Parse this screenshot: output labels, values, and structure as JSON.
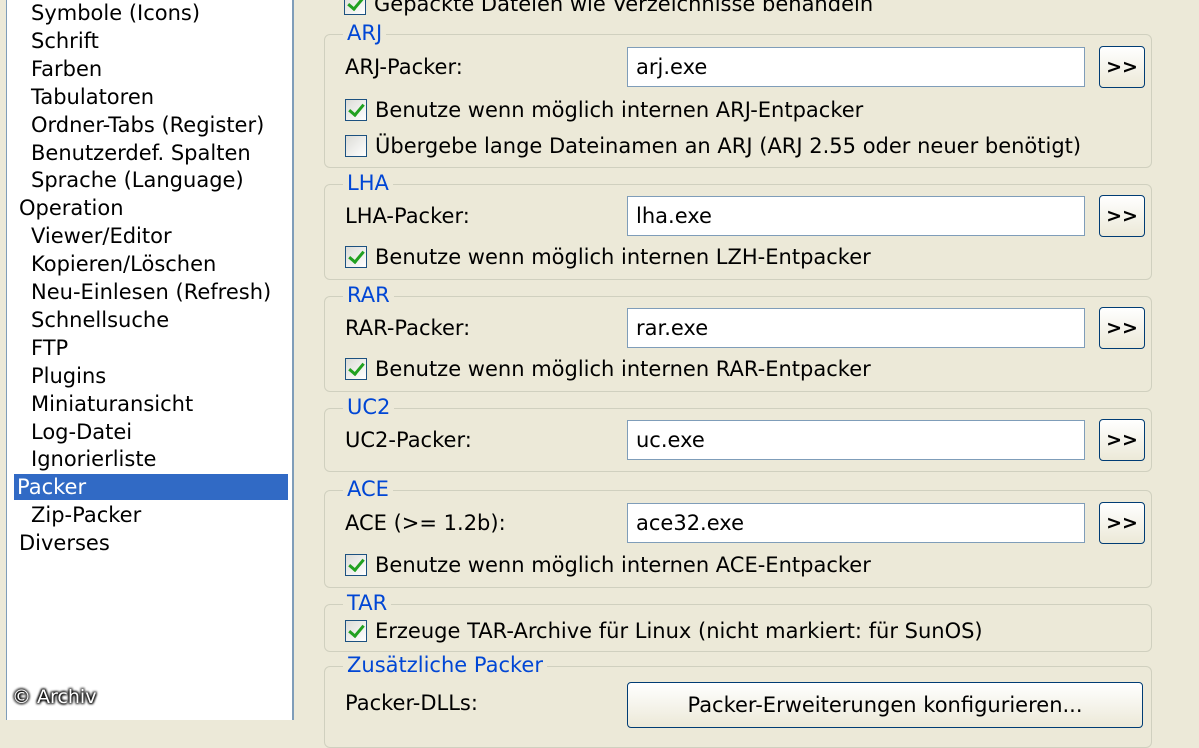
{
  "tree": {
    "items": [
      {
        "label": "Symbole (Icons)",
        "indent": 1
      },
      {
        "label": "Schrift",
        "indent": 1
      },
      {
        "label": "Farben",
        "indent": 1
      },
      {
        "label": "Tabulatoren",
        "indent": 1
      },
      {
        "label": "Ordner-Tabs (Register)",
        "indent": 1
      },
      {
        "label": "Benutzerdef. Spalten",
        "indent": 1
      },
      {
        "label": "Sprache (Language)",
        "indent": 1
      },
      {
        "label": "Operation",
        "indent": 0
      },
      {
        "label": "Viewer/Editor",
        "indent": 1
      },
      {
        "label": "Kopieren/Löschen",
        "indent": 1
      },
      {
        "label": "Neu-Einlesen (Refresh)",
        "indent": 1
      },
      {
        "label": "Schnellsuche",
        "indent": 1
      },
      {
        "label": "FTP",
        "indent": 1
      },
      {
        "label": "Plugins",
        "indent": 1
      },
      {
        "label": "Miniaturansicht",
        "indent": 1
      },
      {
        "label": "Log-Datei",
        "indent": 1
      },
      {
        "label": "Ignorierliste",
        "indent": 1
      },
      {
        "label": "Packer",
        "indent": 0,
        "selected": true
      },
      {
        "label": "Zip-Packer",
        "indent": 1
      },
      {
        "label": "Diverses",
        "indent": 0
      }
    ]
  },
  "watermark": "© Archiv",
  "top_checkbox": {
    "label": "Gepackte Dateien wie Verzeichnisse behandeln",
    "checked": true
  },
  "groups": {
    "arj": {
      "title": "ARJ",
      "packer_label": "ARJ-Packer:",
      "packer_value": "arj.exe",
      "browse": ">>",
      "check1": {
        "label": "Benutze wenn möglich internen ARJ-Entpacker",
        "checked": true
      },
      "check2": {
        "label": "Übergebe lange Dateinamen an ARJ (ARJ 2.55 oder neuer benötigt)",
        "checked": false
      }
    },
    "lha": {
      "title": "LHA",
      "packer_label": "LHA-Packer:",
      "packer_value": "lha.exe",
      "browse": ">>",
      "check1": {
        "label": "Benutze wenn möglich internen LZH-Entpacker",
        "checked": true
      }
    },
    "rar": {
      "title": "RAR",
      "packer_label": "RAR-Packer:",
      "packer_value": "rar.exe",
      "browse": ">>",
      "check1": {
        "label": "Benutze wenn möglich internen RAR-Entpacker",
        "checked": true
      }
    },
    "uc2": {
      "title": "UC2",
      "packer_label": "UC2-Packer:",
      "packer_value": "uc.exe",
      "browse": ">>"
    },
    "ace": {
      "title": "ACE",
      "packer_label": "ACE (>= 1.2b):",
      "packer_value": "ace32.exe",
      "browse": ">>",
      "check1": {
        "label": "Benutze wenn möglich internen ACE-Entpacker",
        "checked": true
      }
    },
    "tar": {
      "title": "TAR",
      "check1": {
        "label": "Erzeuge TAR-Archive für Linux (nicht markiert: für SunOS)",
        "checked": true
      }
    },
    "extra": {
      "title": "Zusätzliche Packer",
      "dll_label": "Packer-DLLs:",
      "configure_button": "Packer-Erweiterungen konfigurieren..."
    }
  },
  "colors": {
    "group_title": "#0046d5",
    "selection": "#316ac5",
    "check_mark": "#21a121"
  }
}
